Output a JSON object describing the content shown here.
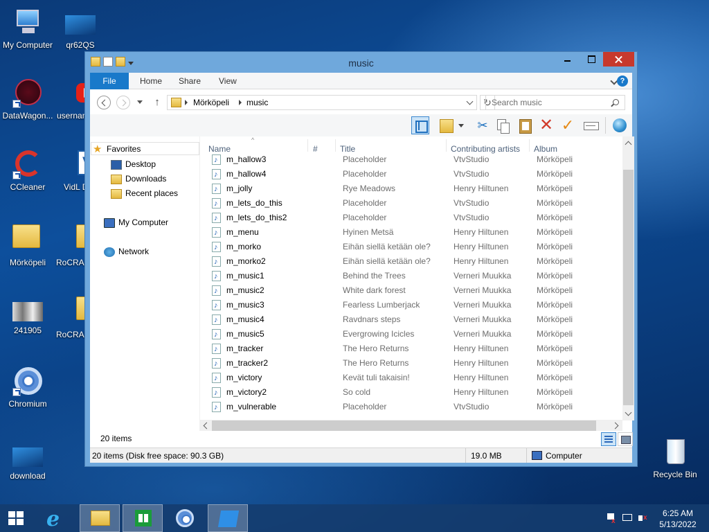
{
  "desktop": {
    "icons": [
      {
        "label": "My Computer"
      },
      {
        "label": "qr62QS"
      },
      {
        "label": "DataWagon..."
      },
      {
        "label": "usernam"
      },
      {
        "label": "CCleaner"
      },
      {
        "label": "VidL Displ"
      },
      {
        "label": "Mörköpeli"
      },
      {
        "label": "RoCRAF"
      },
      {
        "label": "241905"
      },
      {
        "label": "RoCRAF"
      },
      {
        "label": "Chromium"
      },
      {
        "label": "download"
      },
      {
        "label": "Recycle Bin"
      }
    ]
  },
  "window": {
    "title": "music",
    "ribbon_tabs": {
      "file": "File",
      "home": "Home",
      "share": "Share",
      "view": "View"
    },
    "help_label": "?",
    "address": {
      "crumbs": [
        "Mörköpeli",
        "music"
      ]
    },
    "search": {
      "placeholder": "Search music"
    },
    "nav": {
      "favorites": "Favorites",
      "favorite_items": [
        "Desktop",
        "Downloads",
        "Recent places"
      ],
      "computer": "My Computer",
      "network": "Network"
    },
    "columns": {
      "name": "Name",
      "number": "#",
      "title": "Title",
      "artists": "Contributing artists",
      "album": "Album"
    },
    "files": [
      {
        "name": "m_hallow3",
        "title": "Placeholder",
        "artist": "VtvStudio",
        "album": "Mörköpeli"
      },
      {
        "name": "m_hallow4",
        "title": "Placeholder",
        "artist": "VtvStudio",
        "album": "Mörköpeli"
      },
      {
        "name": "m_jolly",
        "title": "Rye Meadows",
        "artist": "Henry Hiltunen",
        "album": "Mörköpeli"
      },
      {
        "name": "m_lets_do_this",
        "title": "Placeholder",
        "artist": "VtvStudio",
        "album": "Mörköpeli"
      },
      {
        "name": "m_lets_do_this2",
        "title": "Placeholder",
        "artist": "VtvStudio",
        "album": "Mörköpeli"
      },
      {
        "name": "m_menu",
        "title": "Hyinen Metsä",
        "artist": "Henry Hiltunen",
        "album": "Mörköpeli"
      },
      {
        "name": "m_morko",
        "title": "Eihän siellä ketään ole?",
        "artist": "Henry Hiltunen",
        "album": "Mörköpeli"
      },
      {
        "name": "m_morko2",
        "title": "Eihän siellä ketään ole?",
        "artist": "Henry Hiltunen",
        "album": "Mörköpeli"
      },
      {
        "name": "m_music1",
        "title": "Behind the Trees",
        "artist": "Verneri Muukka",
        "album": "Mörköpeli"
      },
      {
        "name": "m_music2",
        "title": "White dark forest",
        "artist": "Verneri Muukka",
        "album": "Mörköpeli"
      },
      {
        "name": "m_music3",
        "title": "Fearless Lumberjack",
        "artist": "Verneri Muukka",
        "album": "Mörköpeli"
      },
      {
        "name": "m_music4",
        "title": "Ravdnars steps",
        "artist": "Verneri Muukka",
        "album": "Mörköpeli"
      },
      {
        "name": "m_music5",
        "title": "Evergrowing Icicles",
        "artist": "Verneri Muukka",
        "album": "Mörköpeli"
      },
      {
        "name": "m_tracker",
        "title": "The Hero Returns",
        "artist": "Henry Hiltunen",
        "album": "Mörköpeli"
      },
      {
        "name": "m_tracker2",
        "title": "The Hero Returns",
        "artist": "Henry Hiltunen",
        "album": "Mörköpeli"
      },
      {
        "name": "m_victory",
        "title": "Kevät tuli takaisin!",
        "artist": "Henry Hiltunen",
        "album": "Mörköpeli"
      },
      {
        "name": "m_victory2",
        "title": "So cold",
        "artist": "Henry Hiltunen",
        "album": "Mörköpeli"
      },
      {
        "name": "m_vulnerable",
        "title": "Placeholder",
        "artist": "VtvStudio",
        "album": "Mörköpeli"
      }
    ],
    "item_count": "20 items",
    "status": {
      "left": "20 items (Disk free space: 90.3 GB)",
      "size": "19.0 MB",
      "location": "Computer"
    }
  },
  "taskbar": {
    "clock": {
      "time": "6:25 AM",
      "date": "5/13/2022"
    }
  },
  "colors": {
    "accent": "#1979ca",
    "close": "#c7392d"
  }
}
